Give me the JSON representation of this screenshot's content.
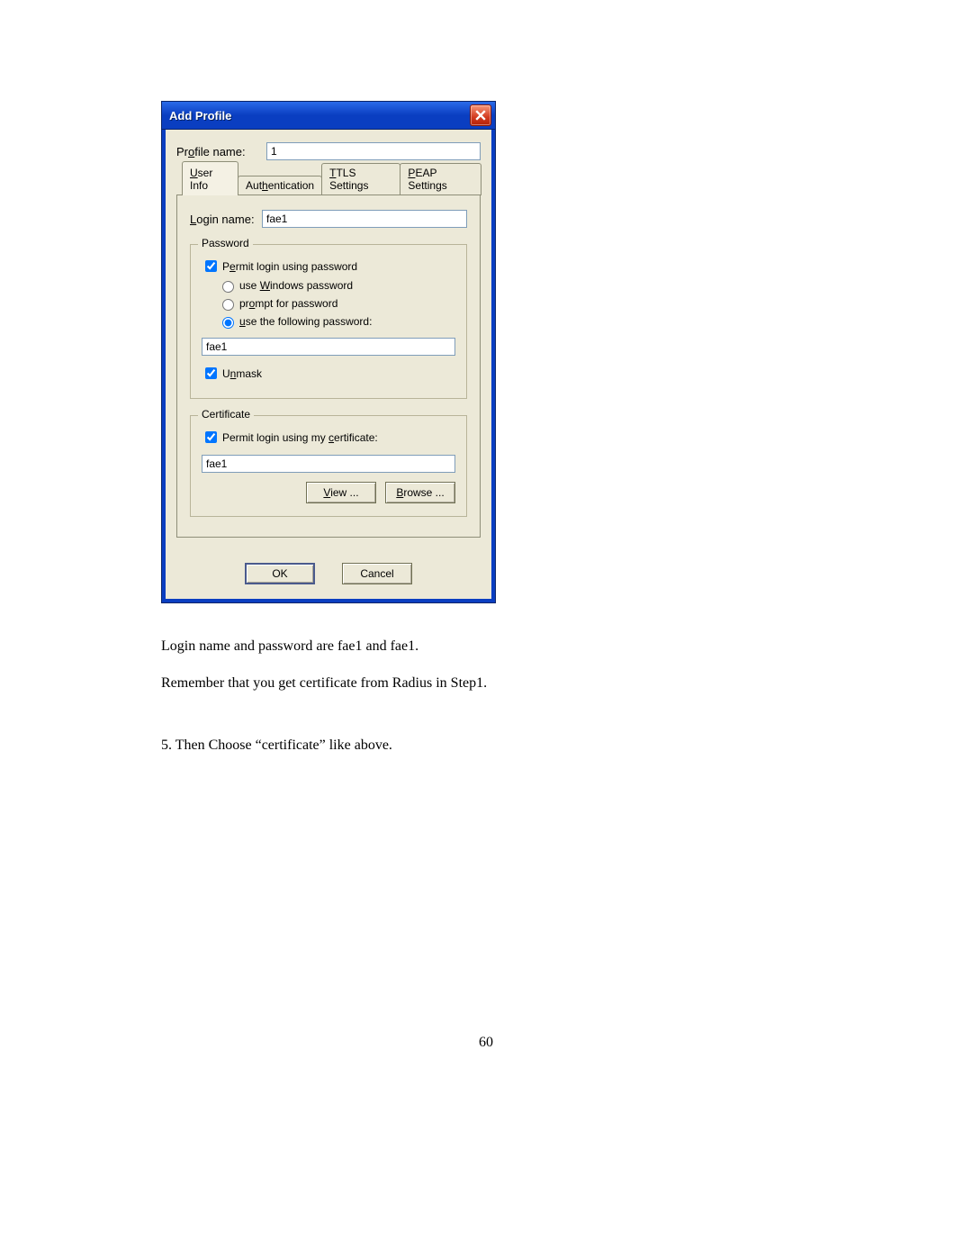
{
  "dialog": {
    "title": "Add Profile",
    "profile_name_label": "Profile name:",
    "profile_name_value": "1",
    "tabs": {
      "user_info": "User Info",
      "authentication": "Authentication",
      "ttls": "TTLS Settings",
      "peap": "PEAP Settings"
    },
    "login_name_label": "Login name:",
    "login_name_value": "fae1",
    "password_group": {
      "title": "Password",
      "permit_label": "Permit login using password",
      "permit_checked": true,
      "radio_windows": "use Windows password",
      "radio_prompt": "prompt for password",
      "radio_following": "use the following password:",
      "radio_selected": "following",
      "password_value": "fae1",
      "unmask_label": "Unmask",
      "unmask_checked": true
    },
    "cert_group": {
      "title": "Certificate",
      "permit_label": "Permit login using my certificate:",
      "permit_checked": true,
      "cert_value": "fae1",
      "view_label": "View ...",
      "browse_label": "Browse ..."
    },
    "buttons": {
      "ok": "OK",
      "cancel": "Cancel"
    }
  },
  "doc": {
    "line1": "Login name and password are fae1 and fae1.",
    "line2": "Remember that you get certificate from Radius in Step1.",
    "line3": "5. Then Choose “certificate” like above.",
    "page_num": "60"
  }
}
